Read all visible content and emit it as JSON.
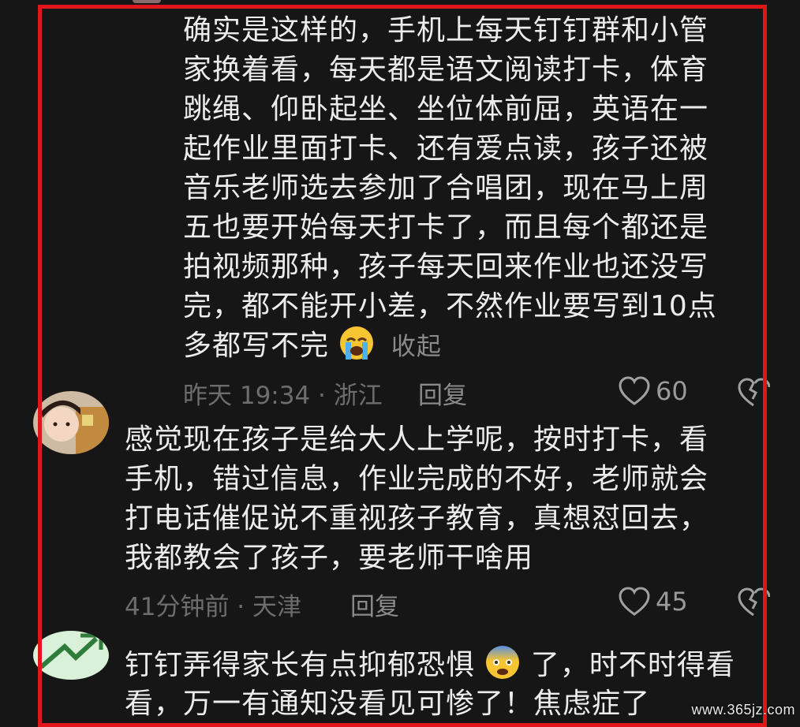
{
  "comments": [
    {
      "lines": [
        "确实是这样的，手机上每天钉钉群和小管",
        "家换着看，每天都是语文阅读打卡，体育",
        "跳绳、仰卧起坐、坐位体前屈，英语在一",
        "起作业里面打卡、还有爱点读，孩子还被",
        "音乐老师选去参加了合唱团，现在马上周",
        "五也要开始每天打卡了，而且每个都还是",
        "拍视频那种，孩子每天回来作业也还没写",
        "完，都不能开小差，不然作业要写到10点",
        "多都写不完"
      ],
      "emoji": "crying-face-emoji",
      "collapse_label": "收起",
      "meta": "昨天 19:34 · 浙江",
      "reply_label": "回复",
      "like_count": "60"
    },
    {
      "lines": [
        "感觉现在孩子是给大人上学呢，按时打卡，看",
        "手机，错过信息，作业完成的不好，老师就会",
        "打电话催促说不重视孩子教育，真想怼回去，",
        "我都教会了孩子，要老师干啥用"
      ],
      "meta": "41分钟前 · 天津",
      "reply_label": "回复",
      "like_count": "45"
    },
    {
      "line1_before": "钉钉弄得家长有点抑郁恐惧",
      "emoji": "anxious-face-emoji",
      "line1_after": "了，时不时得看",
      "line2": "看，万一有通知没看见可惨了！焦虑症了"
    }
  ],
  "watermark": "www.365jz.com",
  "colors": {
    "background": "#161616",
    "frame": "#e0161c",
    "text": "#ececec",
    "meta": "#6d6d6d"
  }
}
